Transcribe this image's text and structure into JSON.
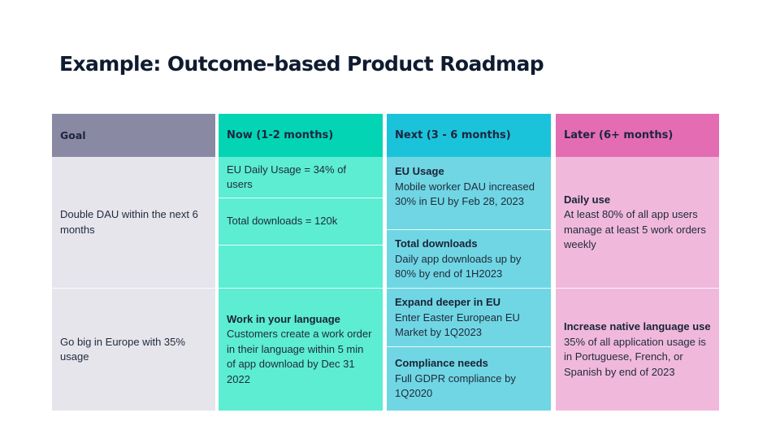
{
  "title": "Example: Outcome-based Product Roadmap",
  "colors": {
    "goal_header": "#8a89a3",
    "goal_body": "#e6e5ec",
    "now_header": "#03d4b3",
    "now_body": "#5cedd3",
    "next_header": "#1bc3da",
    "next_body": "#70d6e4",
    "later_header": "#e46cb3",
    "later_body": "#f0b9dc",
    "title_text": "#0f1b30"
  },
  "columns": {
    "goal": {
      "header": "Goal",
      "rows": [
        "Double DAU within the next 6 months",
        "Go big in Europe with 35% usage"
      ]
    },
    "now": {
      "header": "Now (1-2 months)",
      "items": [
        {
          "title": "",
          "text": "EU Daily Usage = 34% of users"
        },
        {
          "title": "",
          "text": "Total downloads = 120k"
        },
        {
          "title": "",
          "text": ""
        },
        {
          "title": "Work in your language",
          "text": "Customers create a work order in their language within 5 min of app download by Dec 31 2022"
        }
      ]
    },
    "next": {
      "header": "Next (3 - 6 months)",
      "items": [
        {
          "title": "EU Usage",
          "text": "Mobile worker DAU increased 30% in EU by Feb 28, 2023"
        },
        {
          "title": "Total downloads",
          "text": "Daily app downloads up by 80% by end of 1H2023"
        },
        {
          "title": "Expand deeper in EU",
          "text": "Enter Easter European EU Market by 1Q2023"
        },
        {
          "title": "Compliance needs",
          "text": "Full GDPR compliance by 1Q2020"
        }
      ]
    },
    "later": {
      "header": "Later (6+ months)",
      "items": [
        {
          "title": "Daily use",
          "text": "At least 80% of all app users manage at least 5 work orders weekly"
        },
        {
          "title": "Increase native language use",
          "text": "35% of all application usage is in Portuguese, French, or Spanish by end of 2023"
        }
      ]
    }
  }
}
